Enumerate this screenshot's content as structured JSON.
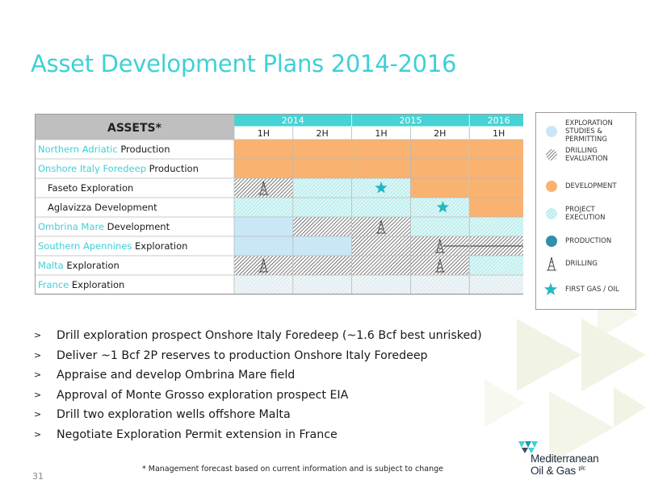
{
  "slide": {
    "title": "Asset Development Plans 2014-2016",
    "page_number": "31",
    "footnote": "* Management forecast based on current information and is subject to change"
  },
  "colors": {
    "accent": "#3fd0d6",
    "development": "#f9b270",
    "exploration_studies": "#c9e7f7",
    "project_execution": "#6ee0dd",
    "production": "#3190a8",
    "drilling_evaluation": "#555555",
    "header_cyan": "#45d3d6",
    "assets_header_bg": "#bfbfbf"
  },
  "gantt": {
    "assets_header": "ASSETS*",
    "years": [
      {
        "label": "2014",
        "span": 2
      },
      {
        "label": "2015",
        "span": 2
      },
      {
        "label": "2016",
        "span": 1
      }
    ],
    "halves": [
      "1H",
      "2H",
      "1H",
      "2H",
      "1H"
    ],
    "rows": [
      {
        "highlight": "Northern Adriatic",
        "rest": " Production",
        "indent": false,
        "cells": [
          "development",
          "development",
          "development",
          "development",
          "development"
        ],
        "markers": []
      },
      {
        "highlight": "Onshore Italy Foredeep",
        "rest": " Production",
        "indent": false,
        "cells": [
          "development",
          "development",
          "development",
          "development",
          "development"
        ],
        "markers": []
      },
      {
        "highlight": "",
        "rest": "Faseto Exploration",
        "indent": true,
        "cells": [
          "drilling_evaluation",
          "project_execution",
          "project_execution",
          "development",
          "development"
        ],
        "markers": [
          {
            "type": "drilling",
            "col": 0,
            "frac": 0.5
          },
          {
            "type": "first_gas",
            "col": 2,
            "frac": 0.5
          }
        ]
      },
      {
        "highlight": "",
        "rest": "Aglavizza Development",
        "indent": true,
        "cells": [
          "project_execution",
          "project_execution",
          "project_execution",
          "project_execution",
          "development"
        ],
        "markers": [
          {
            "type": "first_gas",
            "col": 3,
            "frac": 0.55
          }
        ]
      },
      {
        "highlight": "Ombrina Mare",
        "rest": " Development",
        "indent": false,
        "cells": [
          "exploration_studies",
          "drilling_evaluation",
          "drilling_evaluation",
          "project_execution",
          "project_execution"
        ],
        "markers": [
          {
            "type": "drilling",
            "col": 2,
            "frac": 0.5
          }
        ]
      },
      {
        "highlight": "Southern Apennines",
        "rest": " Exploration",
        "indent": false,
        "cells": [
          "exploration_studies",
          "exploration_studies",
          "drilling_evaluation",
          "drilling_evaluation",
          "drilling_evaluation"
        ],
        "markers": [
          {
            "type": "drilling",
            "col": 3,
            "frac": 0.5
          },
          {
            "type": "arrow",
            "col": 3,
            "frac": 0.55
          }
        ]
      },
      {
        "highlight": "Malta",
        "rest": " Exploration",
        "indent": false,
        "cells": [
          "drilling_evaluation",
          "drilling_evaluation",
          "drilling_evaluation",
          "drilling_evaluation",
          "project_execution"
        ],
        "markers": [
          {
            "type": "drilling",
            "col": 0,
            "frac": 0.5
          },
          {
            "type": "drilling",
            "col": 3,
            "frac": 0.5
          }
        ]
      },
      {
        "highlight": "France",
        "rest": " Exploration",
        "indent": false,
        "cells": [
          "project_execution_light",
          "project_execution_light",
          "project_execution_light",
          "project_execution_light",
          "project_execution_light"
        ],
        "markers": []
      }
    ]
  },
  "legend": {
    "items": [
      {
        "key": "exploration_studies",
        "label": "EXPLORATION STUDIES & PERMITTING",
        "icon": "light-blue-circle-icon"
      },
      {
        "key": "drilling_evaluation",
        "label": "DRILLING EVALUATION",
        "icon": "hatched-circle-icon"
      },
      {
        "key": "development",
        "label": "DEVELOPMENT",
        "icon": "orange-circle-icon"
      },
      {
        "key": "project_execution",
        "label": "PROJECT EXECUTION",
        "icon": "cyan-hatched-circle-icon"
      },
      {
        "key": "production",
        "label": "PRODUCTION",
        "icon": "teal-circle-icon"
      },
      {
        "key": "drilling",
        "label": "DRILLING",
        "icon": "drilling-rig-icon"
      },
      {
        "key": "first_gas",
        "label": "FIRST GAS / OIL",
        "icon": "star-icon"
      }
    ]
  },
  "bullets": [
    "Drill exploration prospect Onshore Italy Foredeep (~1.6 Bcf best unrisked)",
    "Deliver ~1 Bcf 2P reserves to production Onshore Italy Foredeep",
    "Appraise and develop Ombrina Mare field",
    "Approval of Monte Grosso exploration prospect EIA",
    "Drill two exploration wells offshore Malta",
    "Negotiate Exploration Permit extension in France"
  ],
  "bullet_marker": ">",
  "logo": {
    "line1": "Mediterranean",
    "line2": "Oil & Gas",
    "suffix": "plc"
  }
}
